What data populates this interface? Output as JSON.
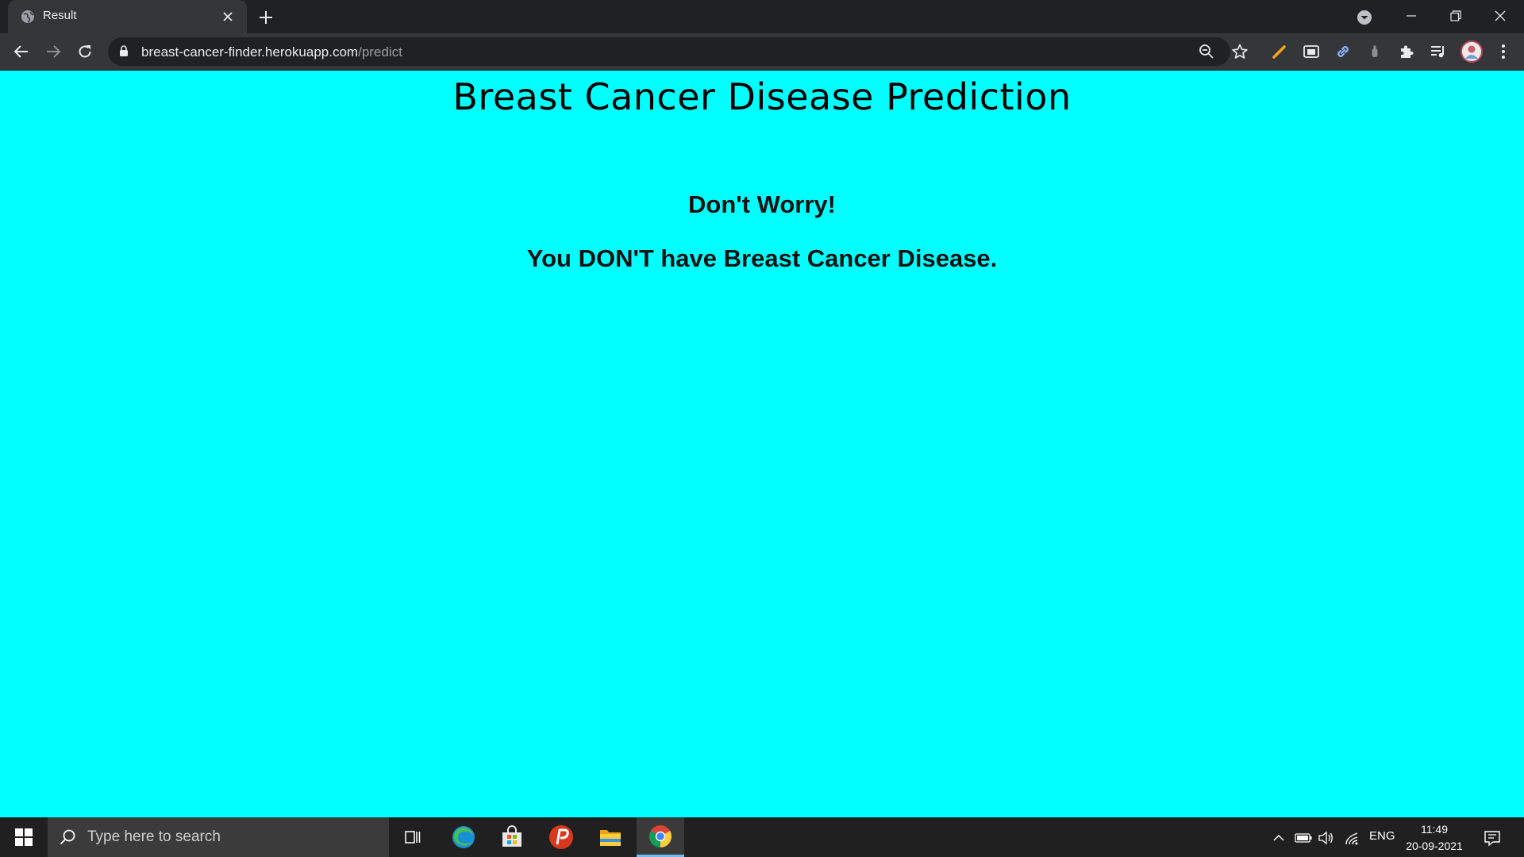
{
  "browser": {
    "tab": {
      "title": "Result"
    },
    "address": {
      "host": "breast-cancer-finder.herokuapp.com",
      "path": "/predict"
    }
  },
  "page": {
    "background": "#00ffff",
    "title": "Breast Cancer Disease Prediction",
    "message_line1": "Don't Worry!",
    "message_line2": "You DON'T have Breast Cancer Disease."
  },
  "taskbar": {
    "search_placeholder": "Type here to search",
    "language": "ENG",
    "time": "11:49",
    "date": "20-09-2021",
    "apps": [
      "task-view",
      "edge",
      "store",
      "psiphon",
      "file-explorer",
      "chrome"
    ]
  },
  "colors": {
    "chrome_dark": "#202124",
    "toolbar": "#35363a",
    "taskbar": "#202020",
    "accent": "#8ab4f8"
  }
}
